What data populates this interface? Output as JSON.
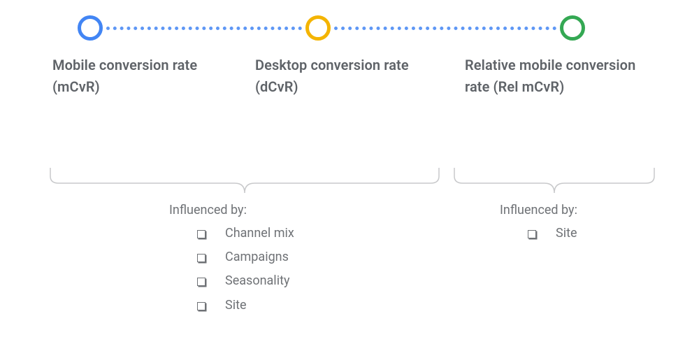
{
  "nodes": [
    {
      "id": "mcvr",
      "label": "Mobile conversion rate (mCvR)",
      "color": "#4285F4"
    },
    {
      "id": "dcvr",
      "label": "Desktop conversion rate (dCvR)",
      "color": "#F4B400"
    },
    {
      "id": "relmcvr",
      "label": "Relative mobile conversion rate (Rel mCvR)",
      "color": "#34A853"
    }
  ],
  "groups": [
    {
      "covers": [
        "mcvr",
        "dcvr"
      ],
      "heading": "Influenced by:",
      "items": [
        "Channel mix",
        "Campaigns",
        "Seasonality",
        "Site"
      ]
    },
    {
      "covers": [
        "relmcvr"
      ],
      "heading": "Influenced by:",
      "items": [
        "Site"
      ]
    }
  ]
}
